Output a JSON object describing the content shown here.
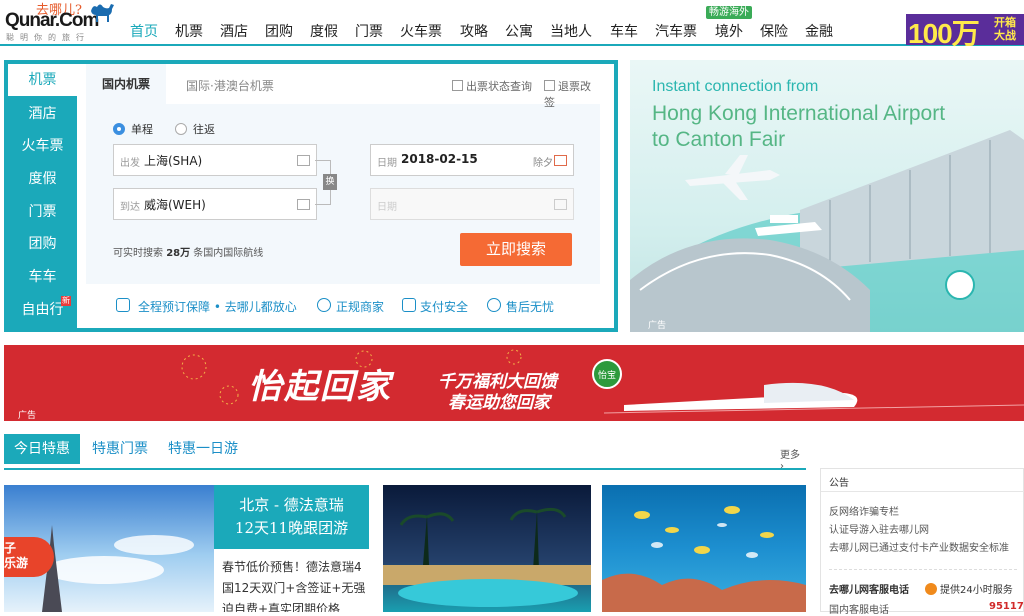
{
  "logo": {
    "slogan": "去哪儿?",
    "brand": "Qunar.Com",
    "tagline": "聪明你的旅行"
  },
  "nav": {
    "items": [
      "首页",
      "机票",
      "酒店",
      "团购",
      "度假",
      "门票",
      "火车票",
      "攻略",
      "公寓",
      "当地人",
      "车车",
      "汽车票",
      "境外",
      "保险",
      "金融"
    ],
    "active": 0,
    "badge": "畅游海外"
  },
  "promo": {
    "big": "100万",
    "small": "开箱大战"
  },
  "search": {
    "side": [
      "机票",
      "酒店",
      "火车票",
      "度假",
      "门票",
      "团购",
      "车车",
      "自由行"
    ],
    "side_badge": "新",
    "tab_domestic": "国内机票",
    "tab_intl": "国际·港澳台机票",
    "link_status": "出票状态查询",
    "link_refund": "退票改签",
    "trip_oneway": "单程",
    "trip_round": "往返",
    "from_label": "出发",
    "from_value": "上海(SHA)",
    "to_label": "到达",
    "to_value": "威海(WEH)",
    "date_label": "日期",
    "date_value": "2018-02-15",
    "date_note": "除夕",
    "return_label": "日期",
    "swap": "换",
    "count_pre": "可实时搜索",
    "count_num": "28万",
    "count_post": "条国内国际航线",
    "button": "立即搜索"
  },
  "guarantee": [
    "全程预订保障 • 去哪儿都放心",
    "正规商家",
    "支付安全",
    "售后无忧"
  ],
  "ad_right": {
    "line1": "Instant connection from",
    "line2": "Hong Kong International Airport",
    "line3": "to Canton Fair",
    "tag": "广告"
  },
  "banner": {
    "main": "怡起回家",
    "sub1": "千万福利大回馈",
    "sub2": "春运助您回家",
    "brand": "怡宝",
    "tag": "广告"
  },
  "deals": {
    "tabs": [
      "今日特惠",
      "特惠门票",
      "特惠一日游"
    ],
    "more": "更多 ›",
    "card1": {
      "title1": "北京 - 德法意瑞",
      "title2": "12天11晚跟团游",
      "desc": "春节低价预售！德法意瑞4国12天双门+含签证+无强迫自费+真实团期价格",
      "ribbon": "子\n乐游"
    }
  },
  "notice": {
    "title": "公告",
    "items": [
      "反网络诈骗专栏",
      "认证导游入驻去哪儿网",
      "去哪儿网已通过支付卡产业数据安全标准"
    ],
    "service": "去哪儿网客服电话",
    "service24": "提供24小时服务",
    "phone_label": "国内客服电话",
    "phone": "95117"
  }
}
